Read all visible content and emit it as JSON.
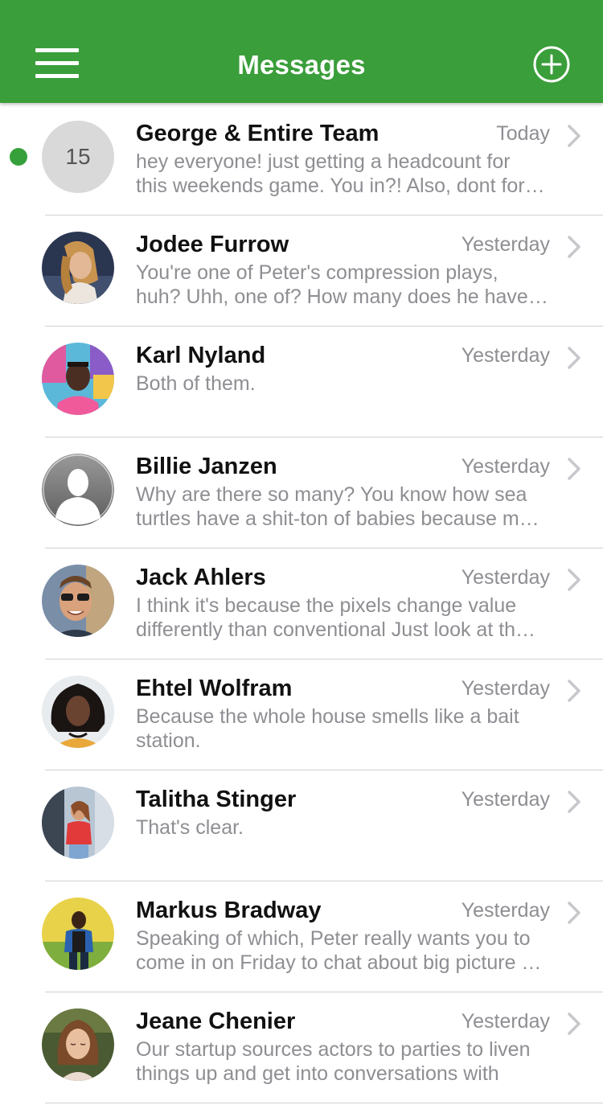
{
  "header": {
    "title": "Messages",
    "background": "#3a9e3a",
    "menu_icon": "hamburger-icon",
    "add_icon": "plus-circle-icon"
  },
  "accent_colors": {
    "unread_dot": "#36a03a",
    "secondary_text": "#8e8e93"
  },
  "conversations": [
    {
      "name": "George & Entire Team",
      "time": "Today",
      "unread": true,
      "avatar_type": "count",
      "avatar_count": "15",
      "preview": [
        "hey everyone! just getting a headcount for",
        "this weekends game. You in?! Also, dont for…"
      ]
    },
    {
      "name": "Jodee Furrow",
      "time": "Yesterday",
      "avatar_type": "photo",
      "preview": [
        "You're one of Peter's compression plays,",
        "huh? Uhh, one of? How many does he have…"
      ]
    },
    {
      "name": "Karl Nyland",
      "time": "Yesterday",
      "avatar_type": "photo",
      "preview": [
        "Both of them.",
        ""
      ]
    },
    {
      "name": "Billie Janzen",
      "time": "Yesterday",
      "avatar_type": "placeholder",
      "preview": [
        "Why are there so many? You know how sea",
        "turtles have a shit-ton of babies because m…"
      ]
    },
    {
      "name": "Jack Ahlers",
      "time": "Yesterday",
      "avatar_type": "photo",
      "preview": [
        "I think it's because the pixels change value",
        "differently than conventional Just look at th…"
      ]
    },
    {
      "name": "Ehtel Wolfram",
      "time": "Yesterday",
      "avatar_type": "photo",
      "preview": [
        "Because the whole house smells like a bait",
        "station."
      ]
    },
    {
      "name": "Talitha Stinger",
      "time": "Yesterday",
      "avatar_type": "photo",
      "preview": [
        "That's clear.",
        ""
      ]
    },
    {
      "name": "Markus Bradway",
      "time": "Yesterday",
      "avatar_type": "photo",
      "preview": [
        "Speaking of which, Peter really wants you to",
        "come in on Friday to chat about big picture …"
      ]
    },
    {
      "name": "Jeane Chenier",
      "time": "Yesterday",
      "avatar_type": "photo",
      "preview": [
        "Our startup sources actors to parties to liven",
        "things up and get into conversations with"
      ]
    }
  ]
}
